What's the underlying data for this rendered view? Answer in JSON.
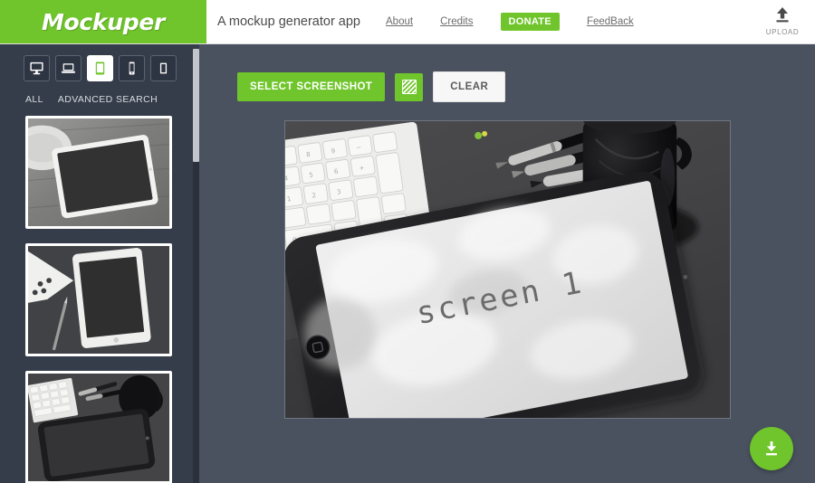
{
  "header": {
    "brand": "Mockuper",
    "tagline": "A mockup generator app",
    "nav": [
      {
        "label": "About",
        "style": "link"
      },
      {
        "label": "Credits",
        "style": "link"
      },
      {
        "label": "DONATE",
        "style": "donate"
      },
      {
        "label": "FeedBack",
        "style": "link"
      }
    ],
    "upload": {
      "label": "UPLOAD",
      "icon": "upload-icon"
    }
  },
  "sidebar": {
    "device_tabs": [
      {
        "name": "desktop",
        "icon": "desktop-icon",
        "active": false
      },
      {
        "name": "laptop",
        "icon": "laptop-icon",
        "active": false
      },
      {
        "name": "tablet",
        "icon": "tablet-icon",
        "active": true
      },
      {
        "name": "phone",
        "icon": "phone-icon",
        "active": false
      },
      {
        "name": "other",
        "icon": "portrait-device-icon",
        "active": false
      }
    ],
    "filters": [
      {
        "label": "ALL"
      },
      {
        "label": "ADVANCED SEARCH"
      }
    ],
    "thumbnails": [
      {
        "name": "white-tablet-on-wood-desk",
        "selected": false
      },
      {
        "name": "white-tablet-portrait-with-pen",
        "selected": false
      },
      {
        "name": "black-tablet-with-keyboard-and-mug",
        "selected": true
      }
    ]
  },
  "toolbar": {
    "select_screenshot_label": "SELECT SCREENSHOT",
    "pattern_icon": "transparency-pattern-icon",
    "clear_label": "CLEAR"
  },
  "preview": {
    "screen_text": "screen 1",
    "mockup_name": "black-tablet-with-keyboard-and-mug"
  },
  "download": {
    "icon": "download-icon"
  },
  "colors": {
    "brand_green": "#6fc52b",
    "sidebar_bg": "#353d4a",
    "main_bg": "#4a5260",
    "header_bg": "#ffffff"
  }
}
